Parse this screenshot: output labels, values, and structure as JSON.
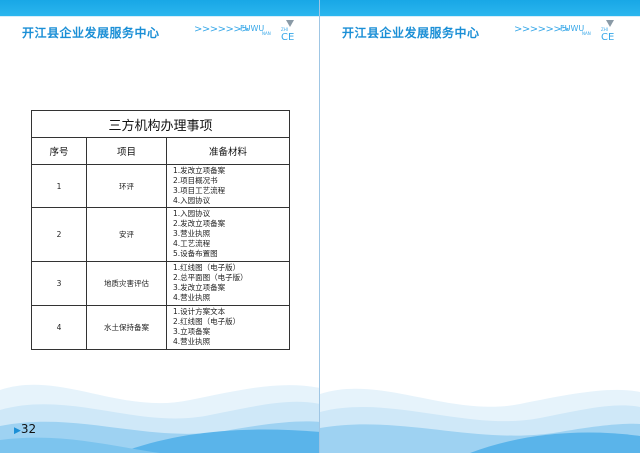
{
  "left_page": {
    "header": {
      "title": "开江县企业发展服务中心",
      "arrows": ">>>>>>>",
      "logo_main": "FUWU",
      "logo_zhi": "ZHI",
      "logo_nan": "NAN",
      "logo_ce": "CE"
    },
    "table": {
      "title": "三方机构办理事项",
      "headers": [
        "序号",
        "项目",
        "准备材料"
      ],
      "rows": [
        {
          "no": "1",
          "item": "环评",
          "materials": [
            "1.发改立项备案",
            "2.项目概况书",
            "3.项目工艺流程",
            "4.入园协议"
          ]
        },
        {
          "no": "2",
          "item": "安评",
          "materials": [
            "1.入园协议",
            "2.发改立项备案",
            "3.营业执照",
            "4.工艺流程",
            "5.设备布置图"
          ]
        },
        {
          "no": "3",
          "item": "地质灾害评估",
          "materials": [
            "1.红线图（电子版）",
            "2.总平面图（电子版）",
            "3.发改立项备案",
            "4.营业执照"
          ]
        },
        {
          "no": "4",
          "item": "水土保持备案",
          "materials": [
            "1.设计方案文本",
            "2.红线图（电子版）",
            "3.立项备案",
            "4.营业执照"
          ]
        }
      ]
    },
    "page_number": "32"
  },
  "right_page": {
    "header": {
      "title": "开江县企业发展服务中心",
      "arrows": ">>>>>>>",
      "logo_main": "FUWU",
      "logo_zhi": "ZHI",
      "logo_nan": "NAN",
      "logo_ce": "CE"
    }
  },
  "colors": {
    "accent": "#1b8fd6",
    "top_bar": "#18a7e6",
    "wave_light": "#cfe8f8",
    "wave_mid": "#9ed2f2",
    "wave_dark": "#5ab4ea"
  }
}
